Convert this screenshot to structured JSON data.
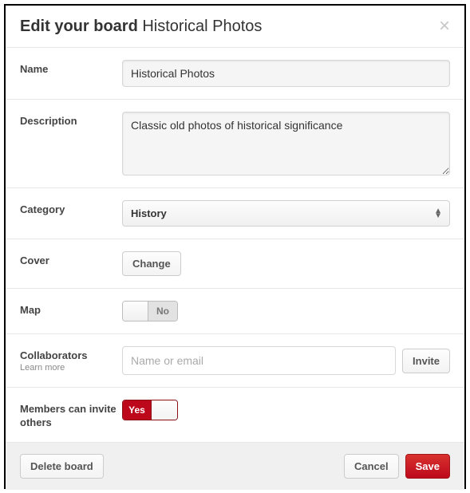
{
  "header": {
    "title_bold": "Edit your board",
    "title_rest": "Historical Photos"
  },
  "form": {
    "name": {
      "label": "Name",
      "value": "Historical Photos"
    },
    "description": {
      "label": "Description",
      "value": "Classic old photos of historical significance"
    },
    "category": {
      "label": "Category",
      "selected": "History"
    },
    "cover": {
      "label": "Cover",
      "button": "Change"
    },
    "map": {
      "label": "Map",
      "value_label": "No"
    },
    "collaborators": {
      "label": "Collaborators",
      "learn_more": "Learn more",
      "placeholder": "Name or email",
      "invite_button": "Invite"
    },
    "members_invite": {
      "label": "Members can invite others",
      "value_label": "Yes"
    }
  },
  "footer": {
    "delete": "Delete board",
    "cancel": "Cancel",
    "save": "Save"
  }
}
